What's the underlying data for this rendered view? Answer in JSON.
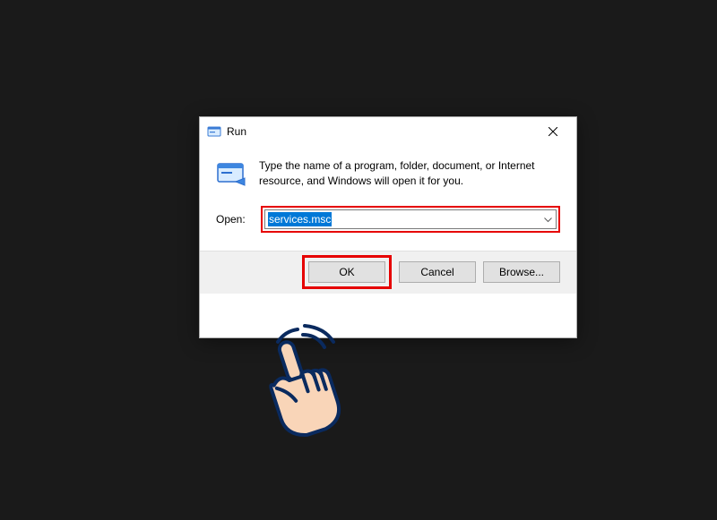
{
  "dialog": {
    "title": "Run",
    "close_label": "Close",
    "info_text": "Type the name of a program, folder, document, or Internet resource, and Windows will open it for you.",
    "open_label": "Open:",
    "input_value": "services.msc",
    "buttons": {
      "ok": "OK",
      "cancel": "Cancel",
      "browse": "Browse..."
    }
  },
  "annotations": {
    "highlight_color": "#e60000",
    "pointer_fill": "#f9d5b8",
    "pointer_stroke": "#0a2a5e"
  }
}
